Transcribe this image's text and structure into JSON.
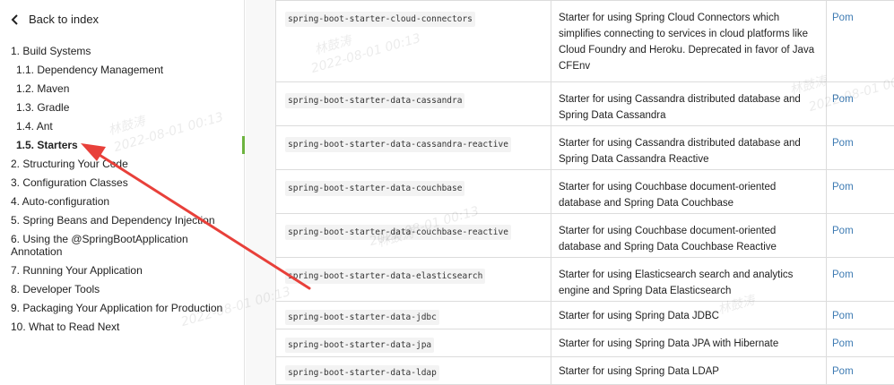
{
  "sidebar": {
    "back_label": "Back to index",
    "toc": [
      {
        "label": "1. Build Systems",
        "level": 0,
        "active": false
      },
      {
        "label": "1.1. Dependency Management",
        "level": 1,
        "active": false
      },
      {
        "label": "1.2. Maven",
        "level": 1,
        "active": false
      },
      {
        "label": "1.3. Gradle",
        "level": 1,
        "active": false
      },
      {
        "label": "1.4. Ant",
        "level": 1,
        "active": false
      },
      {
        "label": "1.5. Starters",
        "level": 1,
        "active": true
      },
      {
        "label": "2. Structuring Your Code",
        "level": 0,
        "active": false
      },
      {
        "label": "3. Configuration Classes",
        "level": 0,
        "active": false
      },
      {
        "label": "4. Auto-configuration",
        "level": 0,
        "active": false
      },
      {
        "label": "5. Spring Beans and Dependency Injection",
        "level": 0,
        "active": false
      },
      {
        "label": "6. Using the @SpringBootApplication Annotation",
        "level": 0,
        "active": false
      },
      {
        "label": "7. Running Your Application",
        "level": 0,
        "active": false
      },
      {
        "label": "8. Developer Tools",
        "level": 0,
        "active": false
      },
      {
        "label": "9. Packaging Your Application for Production",
        "level": 0,
        "active": false
      },
      {
        "label": "10. What to Read Next",
        "level": 0,
        "active": false
      }
    ]
  },
  "table": {
    "rows": [
      {
        "name": "spring-boot-starter-cloud-connectors",
        "description": "Starter for using Spring Cloud Connectors which simplifies connecting to services in cloud platforms like Cloud Foundry and Heroku. Deprecated in favor of Java CFEnv",
        "link": "Pom"
      },
      {
        "name": "spring-boot-starter-data-cassandra",
        "description": "Starter for using Cassandra distributed database and Spring Data Cassandra",
        "link": "Pom"
      },
      {
        "name": "spring-boot-starter-data-cassandra-reactive",
        "description": "Starter for using Cassandra distributed database and Spring Data Cassandra Reactive",
        "link": "Pom"
      },
      {
        "name": "spring-boot-starter-data-couchbase",
        "description": "Starter for using Couchbase document-oriented database and Spring Data Couchbase",
        "link": "Pom"
      },
      {
        "name": "spring-boot-starter-data-couchbase-reactive",
        "description": "Starter for using Couchbase document-oriented database and Spring Data Couchbase Reactive",
        "link": "Pom"
      },
      {
        "name": "spring-boot-starter-data-elasticsearch",
        "description": "Starter for using Elasticsearch search and analytics engine and Spring Data Elasticsearch",
        "link": "Pom"
      },
      {
        "name": "spring-boot-starter-data-jdbc",
        "description": "Starter for using Spring Data JDBC",
        "link": "Pom"
      },
      {
        "name": "spring-boot-starter-data-jpa",
        "description": "Starter for using Spring Data JPA with Hibernate",
        "link": "Pom"
      },
      {
        "name": "spring-boot-starter-data-ldap",
        "description": "Starter for using Spring Data LDAP",
        "link": "Pom"
      }
    ]
  },
  "watermark": {
    "name": "林鼓涛",
    "date": "2022-08-01 00:13"
  },
  "colors": {
    "link": "#3e7bb3",
    "accent": "#6db33f",
    "arrow": "#e8403a"
  },
  "icons": {
    "back": "chevron-left-icon"
  }
}
